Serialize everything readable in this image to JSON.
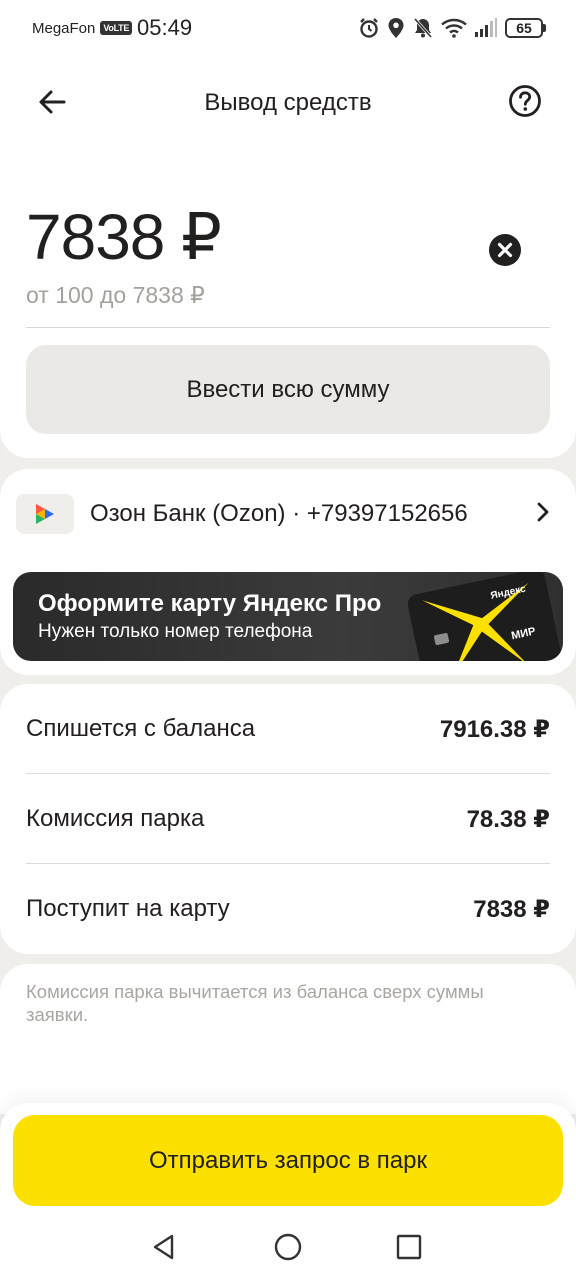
{
  "status_bar": {
    "carrier": "MegaFon",
    "volte": "VoLTE",
    "time": "05:49",
    "battery": "65",
    "icons": [
      "alarm-icon",
      "location-icon",
      "bell-off-icon",
      "wifi-icon",
      "signal-icon",
      "battery-icon"
    ]
  },
  "header": {
    "title": "Вывод средств",
    "back_icon": "arrow-left-icon",
    "help_icon": "question-circle-icon"
  },
  "amount": {
    "value": "7838 ₽",
    "range": "от 100 до 7838 ₽",
    "clear_icon": "clear-x-icon",
    "fill_all_label": "Ввести всю сумму"
  },
  "bank": {
    "name": "Озон Банк (Ozon) · +79397152656",
    "logo_icon": "ozon-bank-logo-icon",
    "chevron_icon": "chevron-right-icon"
  },
  "promo": {
    "title": "Оформите карту Яндекс Про",
    "subtitle": "Нужен только номер телефона",
    "card_brand": "Яндекс",
    "card_network": "МИР"
  },
  "summary": {
    "rows": [
      {
        "label": "Спишется с баланса",
        "value": "7916.38 ₽"
      },
      {
        "label": "Комиссия парка",
        "value": "78.38 ₽"
      },
      {
        "label": "Поступит на карту",
        "value": "7838 ₽"
      }
    ]
  },
  "note": "Комиссия парка вычитается из баланса сверх суммы заявки.",
  "submit_label": "Отправить запрос в парк",
  "colors": {
    "accent": "#fce000",
    "background": "#f0eeeb",
    "card": "#ffffff",
    "text": "#21201f",
    "muted": "#a4a19c"
  }
}
